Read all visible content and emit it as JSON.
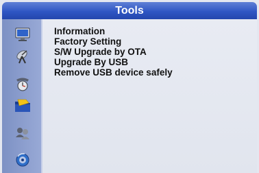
{
  "header": {
    "title": "Tools"
  },
  "sidebar": {
    "icons": [
      {
        "name": "monitor-icon"
      },
      {
        "name": "satellite-dish-icon"
      },
      {
        "name": "clock-icon"
      },
      {
        "name": "tools-folder-icon"
      },
      {
        "name": "users-icon"
      },
      {
        "name": "disc-icon"
      }
    ],
    "selected_index": 3
  },
  "menu": {
    "items": [
      "Information",
      "Factory Setting",
      "S/W Upgrade by OTA",
      "Upgrade By USB",
      "Remove USB device safely"
    ]
  }
}
